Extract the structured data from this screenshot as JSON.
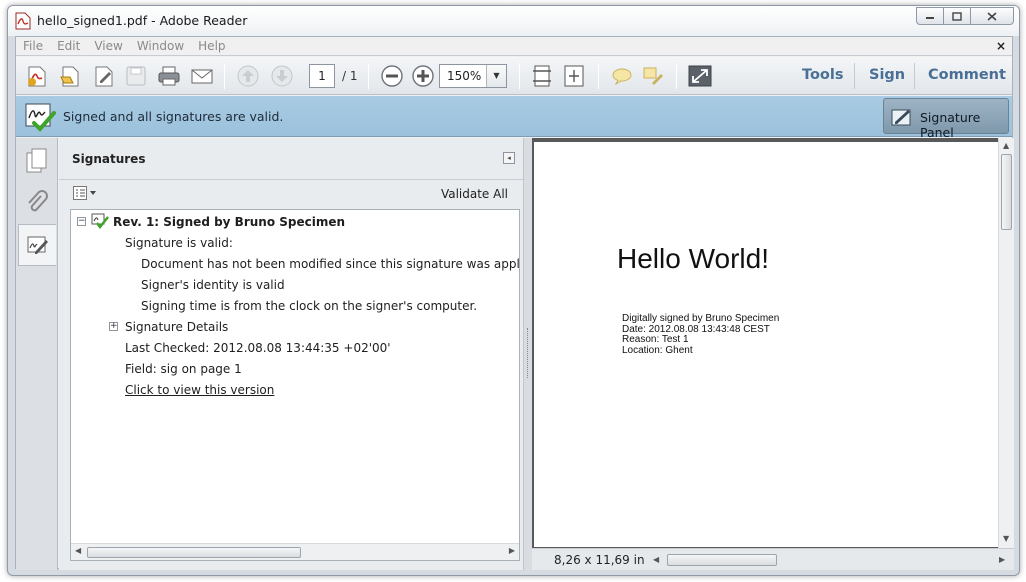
{
  "window": {
    "title": "hello_signed1.pdf - Adobe Reader",
    "controls": {
      "minimize": "▭",
      "maximize": "▢",
      "close": "✕"
    }
  },
  "menu": {
    "items": [
      "File",
      "Edit",
      "View",
      "Window",
      "Help"
    ],
    "close_glyph": "×"
  },
  "toolbar": {
    "page_current": "1",
    "page_total": "/ 1",
    "zoom": "150%",
    "zoom_arrow": "▼",
    "tools_label": "Tools",
    "sign_label": "Sign",
    "comment_label": "Comment"
  },
  "banner": {
    "message": "Signed and all signatures are valid.",
    "signature_panel_label": "Signature Panel"
  },
  "signatures_panel": {
    "title": "Signatures",
    "collapse_glyph": "◂",
    "validate_all": "Validate All",
    "tree": {
      "revision": "Rev. 1: Signed by Bruno Specimen",
      "status": "Signature is valid:",
      "details": [
        "Document has not been modified since this signature was applied",
        "Signer's identity is valid",
        "Signing time is from the clock on the signer's computer."
      ],
      "signature_details": "Signature Details",
      "last_checked": "Last Checked: 2012.08.08 13:44:35 +02'00'",
      "field": "Field: sig on page 1",
      "view_version_link": "Click to view this version",
      "minus_glyph": "−",
      "plus_glyph": "+"
    }
  },
  "document": {
    "heading": "Hello World!",
    "signature_lines": [
      "Digitally signed by Bruno Specimen",
      "Date: 2012.08.08 13:43:48 CEST",
      "Reason: Test 1",
      "Location: Ghent"
    ],
    "page_size": "8,26 x 11,69 in"
  },
  "colors": {
    "banner_bg": "#a9cbe3",
    "link_blue": "#4a6f95",
    "valid_green": "#3fa52a",
    "pdf_red": "#c0332b"
  }
}
